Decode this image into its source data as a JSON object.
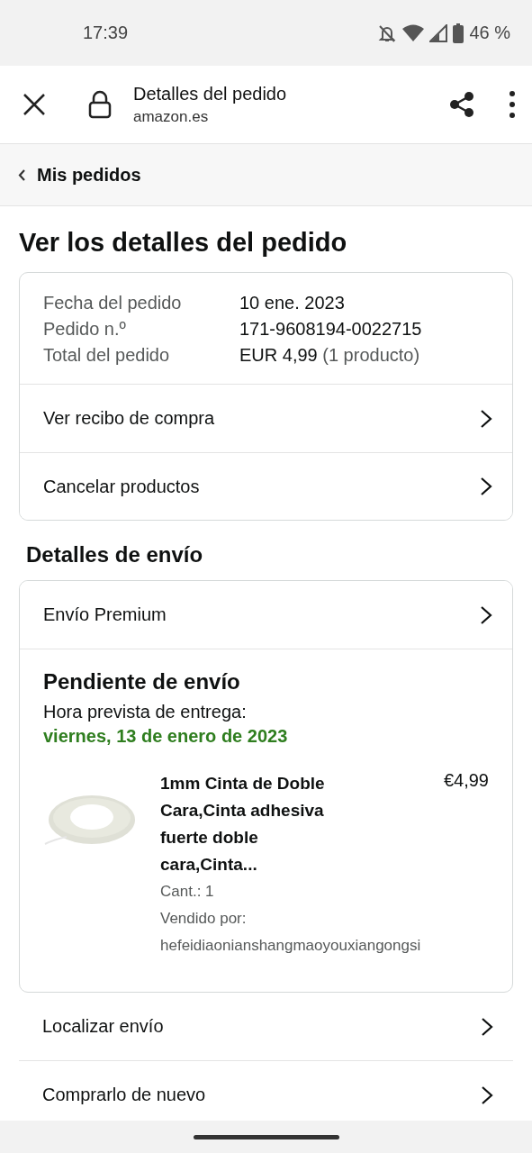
{
  "status_bar": {
    "time": "17:39",
    "battery": "46 %"
  },
  "browser_bar": {
    "title": "Detalles del pedido",
    "url": "amazon.es"
  },
  "breadcrumb": {
    "label": "Mis pedidos"
  },
  "heading": "Ver los detalles del pedido",
  "order_summary": {
    "rows": [
      {
        "label": "Fecha del pedido",
        "value": "10 ene. 2023"
      },
      {
        "label": "Pedido n.º",
        "value": "171-9608194-0022715"
      },
      {
        "label": "Total del pedido",
        "value": "EUR 4,99",
        "note": "(1 producto)"
      }
    ],
    "links": [
      "Ver recibo de compra",
      "Cancelar productos"
    ]
  },
  "shipping": {
    "heading": "Detalles de envío",
    "method": "Envío Premium",
    "status": "Pendiente de envío",
    "eta_label": "Hora prevista de entrega:",
    "eta": "viernes, 13 de enero de 2023",
    "product": {
      "kind": "picture",
      "title": "1mm Cinta de Doble Cara,Cinta adhesiva fuerte doble cara,Cinta...",
      "price": "€4,99",
      "quantity": "Cant.: 1",
      "seller_label": "Vendido por:",
      "seller": "hefeidiaonianshangmaoyouxiangongsi"
    }
  },
  "actions": [
    "Localizar envío",
    "Comprarlo de nuevo"
  ]
}
